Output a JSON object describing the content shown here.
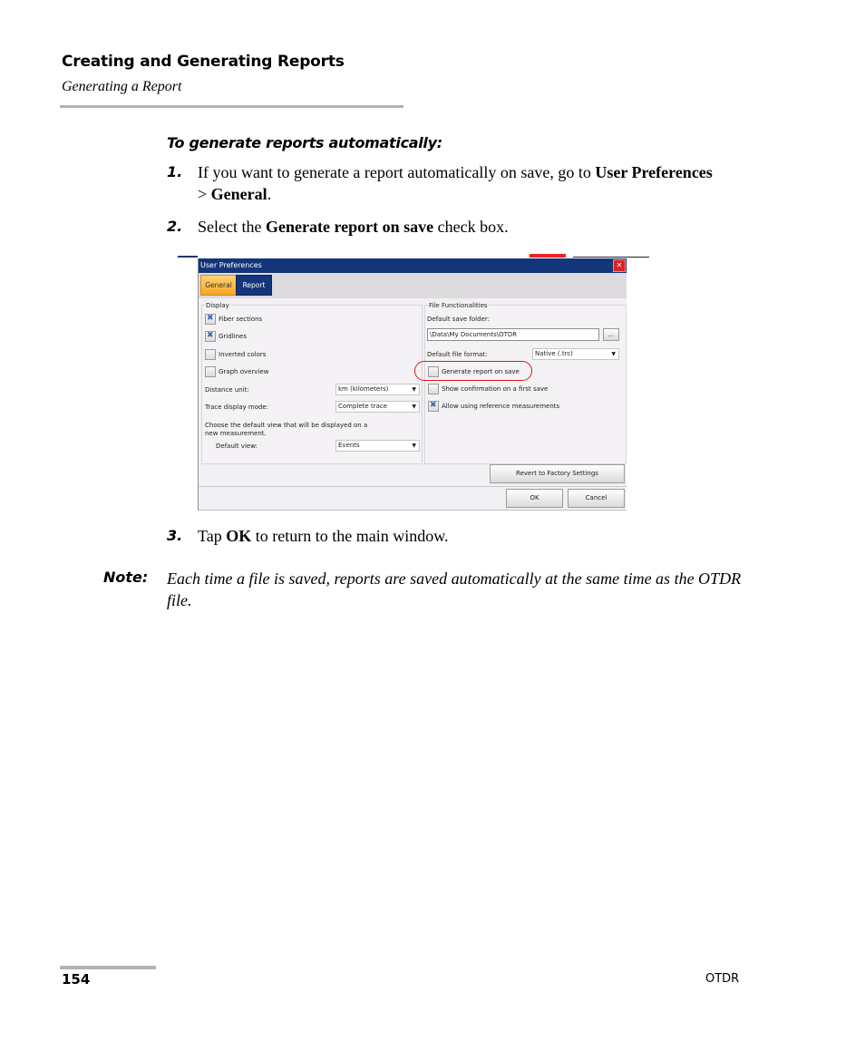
{
  "header": {
    "chapter_title": "Creating and Generating Reports",
    "section_title": "Generating a Report"
  },
  "procedure": {
    "title": "To generate reports automatically:",
    "steps": [
      {
        "number": "1.",
        "text_before": "If you want to generate a report automatically on save, go to ",
        "bold1": "User Preferences",
        "separator": " > ",
        "bold2": "General",
        "text_after": "."
      },
      {
        "number": "2.",
        "text_before": "Select the ",
        "bold": "Generate report on save",
        "text_after": " check box."
      },
      {
        "number": "3.",
        "text_before": "Tap ",
        "bold": "OK",
        "text_after": " to return to the main window."
      }
    ]
  },
  "note": {
    "label": "Note:",
    "text": "Each time a file is saved, reports are saved automatically at the same time as the OTDR file."
  },
  "footer": {
    "page_number": "154",
    "product": "OTDR"
  },
  "dialog": {
    "title": "User Preferences",
    "close_icon": "close-icon",
    "tabs": [
      {
        "label": "General",
        "active": true
      },
      {
        "label": "Report",
        "active": false
      }
    ],
    "display": {
      "group_label": "Display",
      "checkboxes": [
        {
          "label": "Fiber sections",
          "checked": true
        },
        {
          "label": "Gridlines",
          "checked": true
        },
        {
          "label": "Inverted colors",
          "checked": false
        },
        {
          "label": "Graph overview",
          "checked": false
        }
      ],
      "distance_unit_label": "Distance unit:",
      "distance_unit_value": "km (kilometers)",
      "trace_mode_label": "Trace display mode:",
      "trace_mode_value": "Complete trace",
      "default_view_hint": "Choose the default view that will be displayed on a new measurement.",
      "default_view_label": "Default view:",
      "default_view_value": "Events"
    },
    "file": {
      "group_label": "File Functionalities",
      "save_folder_label": "Default save folder:",
      "save_folder_value": "\\Data\\My Documents\\OTDR",
      "browse_label": "...",
      "file_format_label": "Default file format:",
      "file_format_value": "Native (.trc)",
      "checkboxes": [
        {
          "label": "Generate report on save",
          "checked": false
        },
        {
          "label": "Show confirmation on a first save",
          "checked": false
        },
        {
          "label": "Allow using reference measurements",
          "checked": true
        }
      ]
    },
    "revert_label": "Revert to Factory Settings",
    "ok_label": "OK",
    "cancel_label": "Cancel",
    "highlight_color": "#e0191b",
    "titlebar_color": "#13357a",
    "active_tab_color": "#f5a623"
  }
}
